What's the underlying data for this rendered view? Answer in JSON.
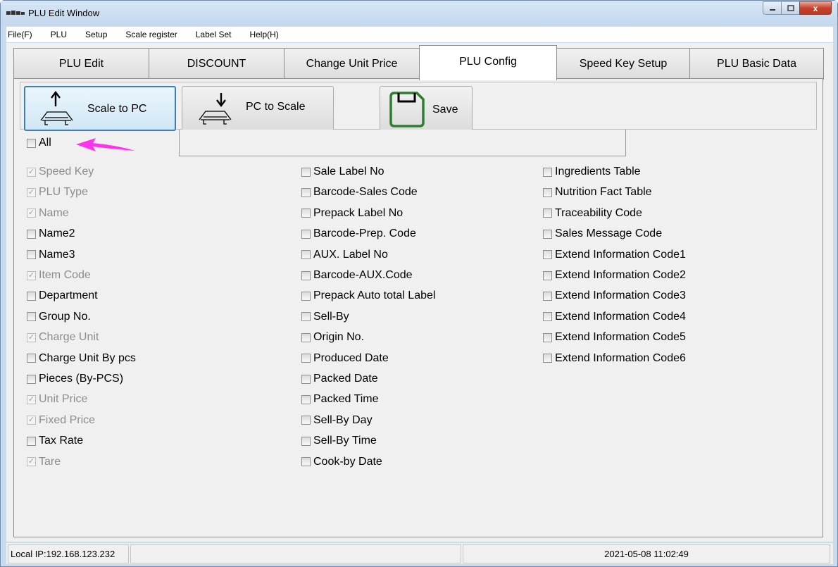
{
  "window": {
    "title": "PLU Edit Window",
    "controls": {
      "minimize": "minimize-icon",
      "maximize": "maximize-icon",
      "close": "x"
    }
  },
  "menu": [
    "File(F)",
    "PLU",
    "Setup",
    "Scale register",
    "Label Set",
    "Help(H)"
  ],
  "tabs": [
    {
      "label": "PLU Edit"
    },
    {
      "label": "DISCOUNT"
    },
    {
      "label": "Change Unit Price"
    },
    {
      "label": "PLU Config",
      "active": true
    },
    {
      "label": "Speed Key Setup"
    },
    {
      "label": "PLU Basic Data"
    }
  ],
  "toolbar": {
    "scale_to_pc": "Scale to PC",
    "pc_to_scale": "PC to Scale",
    "save": "Save"
  },
  "all_checkbox": {
    "label": "All",
    "checked": false
  },
  "columns": [
    [
      {
        "label": "Speed Key",
        "checked": true,
        "disabled": true
      },
      {
        "label": "PLU Type",
        "checked": true,
        "disabled": true
      },
      {
        "label": "Name",
        "checked": true,
        "disabled": true
      },
      {
        "label": "Name2",
        "checked": false,
        "disabled": false
      },
      {
        "label": "Name3",
        "checked": false,
        "disabled": false
      },
      {
        "label": "Item Code",
        "checked": true,
        "disabled": true
      },
      {
        "label": "Department",
        "checked": false,
        "disabled": false
      },
      {
        "label": "Group No.",
        "checked": false,
        "disabled": false
      },
      {
        "label": "Charge Unit",
        "checked": true,
        "disabled": true
      },
      {
        "label": "Charge Unit By pcs",
        "checked": false,
        "disabled": false
      },
      {
        "label": "Pieces (By-PCS)",
        "checked": false,
        "disabled": false
      },
      {
        "label": "Unit Price",
        "checked": true,
        "disabled": true
      },
      {
        "label": "Fixed Price",
        "checked": true,
        "disabled": true
      },
      {
        "label": "Tax Rate",
        "checked": false,
        "disabled": false
      },
      {
        "label": "Tare",
        "checked": true,
        "disabled": true
      }
    ],
    [
      {
        "label": "Sale Label No",
        "checked": false,
        "disabled": false
      },
      {
        "label": "Barcode-Sales Code",
        "checked": false,
        "disabled": false
      },
      {
        "label": "Prepack Label No",
        "checked": false,
        "disabled": false
      },
      {
        "label": "Barcode-Prep. Code",
        "checked": false,
        "disabled": false
      },
      {
        "label": "AUX. Label No",
        "checked": false,
        "disabled": false
      },
      {
        "label": "Barcode-AUX.Code",
        "checked": false,
        "disabled": false
      },
      {
        "label": "Prepack Auto total Label",
        "checked": false,
        "disabled": false
      },
      {
        "label": "Sell-By",
        "checked": false,
        "disabled": false
      },
      {
        "label": "Origin No.",
        "checked": false,
        "disabled": false
      },
      {
        "label": "Produced Date",
        "checked": false,
        "disabled": false
      },
      {
        "label": "Packed Date",
        "checked": false,
        "disabled": false
      },
      {
        "label": "Packed Time",
        "checked": false,
        "disabled": false
      },
      {
        "label": "Sell-By Day",
        "checked": false,
        "disabled": false
      },
      {
        "label": "Sell-By Time",
        "checked": false,
        "disabled": false
      },
      {
        "label": "Cook-by Date",
        "checked": false,
        "disabled": false
      }
    ],
    [
      {
        "label": "Ingredients Table",
        "checked": false,
        "disabled": false
      },
      {
        "label": "Nutrition Fact Table",
        "checked": false,
        "disabled": false
      },
      {
        "label": "Traceability Code",
        "checked": false,
        "disabled": false
      },
      {
        "label": "Sales Message Code",
        "checked": false,
        "disabled": false
      },
      {
        "label": "Extend Information Code1",
        "checked": false,
        "disabled": false
      },
      {
        "label": "Extend Information Code2",
        "checked": false,
        "disabled": false
      },
      {
        "label": "Extend Information Code3",
        "checked": false,
        "disabled": false
      },
      {
        "label": "Extend Information Code4",
        "checked": false,
        "disabled": false
      },
      {
        "label": "Extend Information Code5",
        "checked": false,
        "disabled": false
      },
      {
        "label": "Extend Information Code6",
        "checked": false,
        "disabled": false
      }
    ]
  ],
  "status": {
    "local_ip": "Local IP:192.168.123.232",
    "datetime": "2021-05-08 11:02:49"
  },
  "colors": {
    "annotation_arrow": "#ff33ee",
    "save_icon": "#2e7d32",
    "focus_border": "#3c7fb1"
  }
}
